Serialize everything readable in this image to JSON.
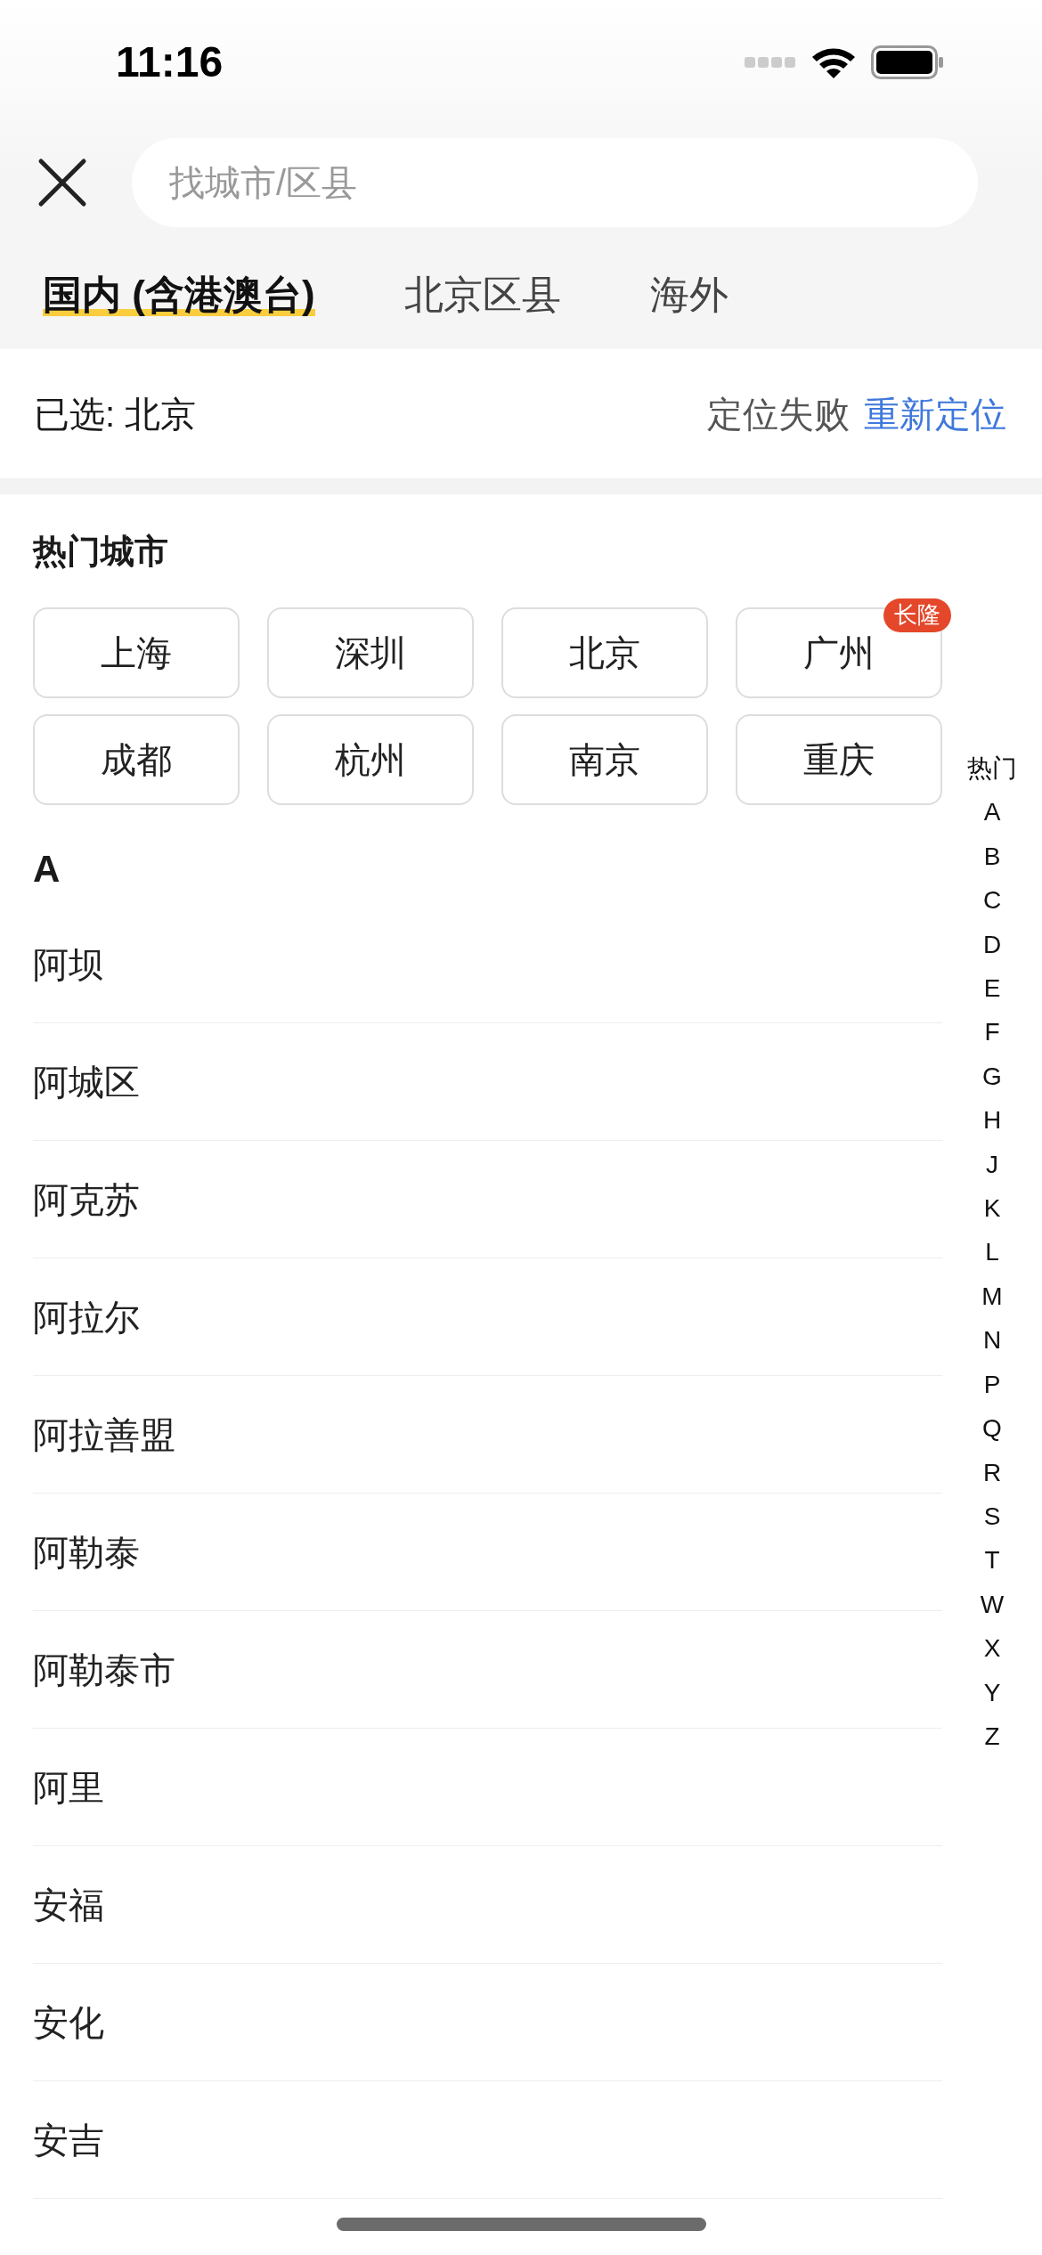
{
  "status_bar": {
    "time": "11:16"
  },
  "search": {
    "placeholder": "找城市/区县"
  },
  "tabs": [
    {
      "label": "国内 (含港澳台)",
      "selected": true
    },
    {
      "label": "北京区县",
      "selected": false
    },
    {
      "label": "海外",
      "selected": false
    }
  ],
  "selection": {
    "label": "已选: 北京",
    "location_status": "定位失败",
    "relocate": "重新定位"
  },
  "hot_cities": {
    "title": "热门城市",
    "cities": [
      {
        "name": "上海"
      },
      {
        "name": "深圳"
      },
      {
        "name": "北京"
      },
      {
        "name": "广州",
        "badge": "长隆"
      },
      {
        "name": "成都"
      },
      {
        "name": "杭州"
      },
      {
        "name": "南京"
      },
      {
        "name": "重庆"
      }
    ]
  },
  "sections": [
    {
      "letter": "A",
      "cities": [
        "阿坝",
        "阿城区",
        "阿克苏",
        "阿拉尔",
        "阿拉善盟",
        "阿勒泰",
        "阿勒泰市",
        "阿里",
        "安福",
        "安化",
        "安吉"
      ]
    }
  ],
  "index": [
    "热门",
    "A",
    "B",
    "C",
    "D",
    "E",
    "F",
    "G",
    "H",
    "J",
    "K",
    "L",
    "M",
    "N",
    "P",
    "Q",
    "R",
    "S",
    "T",
    "W",
    "X",
    "Y",
    "Z"
  ]
}
